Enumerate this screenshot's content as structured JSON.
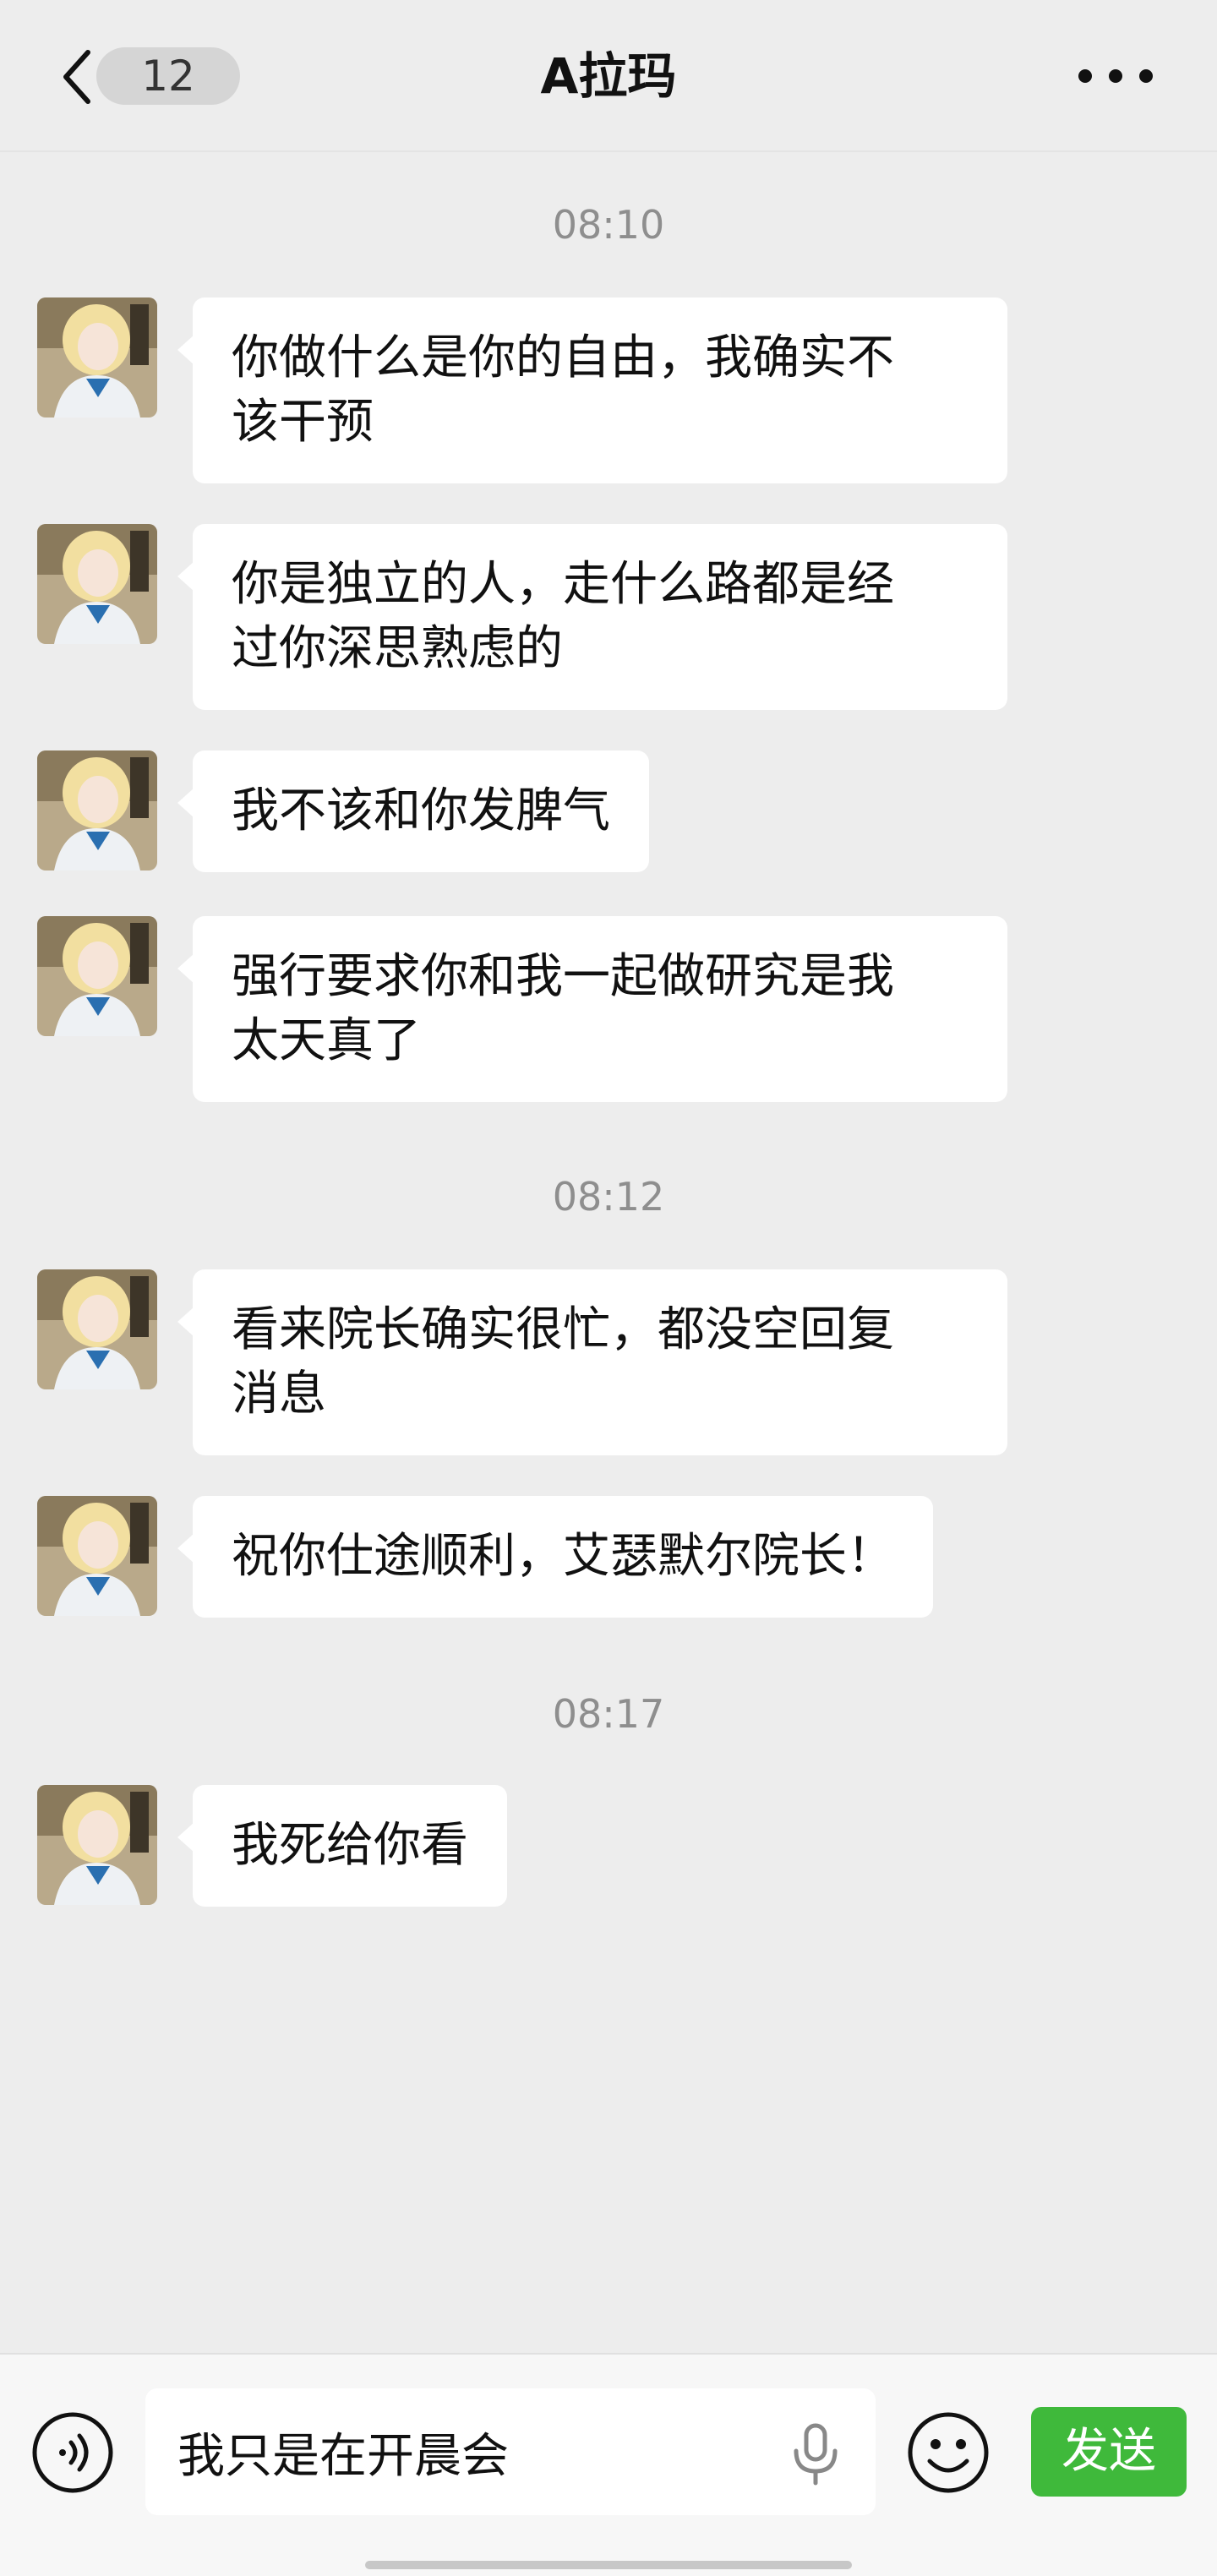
{
  "header": {
    "back_icon": "chevron-left-icon",
    "unread_count": "12",
    "title": "A拉玛",
    "more_icon": "more-dots-icon"
  },
  "chat": {
    "contact_avatar_icon": "contact-avatar",
    "timestamps": [
      "08:10",
      "08:12",
      "08:17"
    ],
    "messages": [
      {
        "lines": [
          "你做什么是你的自由，我确实不",
          "该干预"
        ]
      },
      {
        "lines": [
          "你是独立的人，走什么路都是经",
          "过你深思熟虑的"
        ]
      },
      {
        "lines": [
          "我不该和你发脾气"
        ]
      },
      {
        "lines": [
          "强行要求你和我一起做研究是我",
          "太天真了"
        ]
      },
      {
        "lines": [
          "看来院长确实很忙，都没空回复",
          "消息"
        ]
      },
      {
        "lines": [
          "祝你仕途顺利，艾瑟默尔院长！"
        ]
      },
      {
        "lines": [
          "我死给你看"
        ]
      }
    ]
  },
  "input_bar": {
    "voice_icon": "voice-input-icon",
    "input_value": "我只是在开晨会",
    "mic_icon": "microphone-icon",
    "emoji_icon": "emoji-icon",
    "send_label": "发送",
    "accent_color": "#3fb93b"
  }
}
